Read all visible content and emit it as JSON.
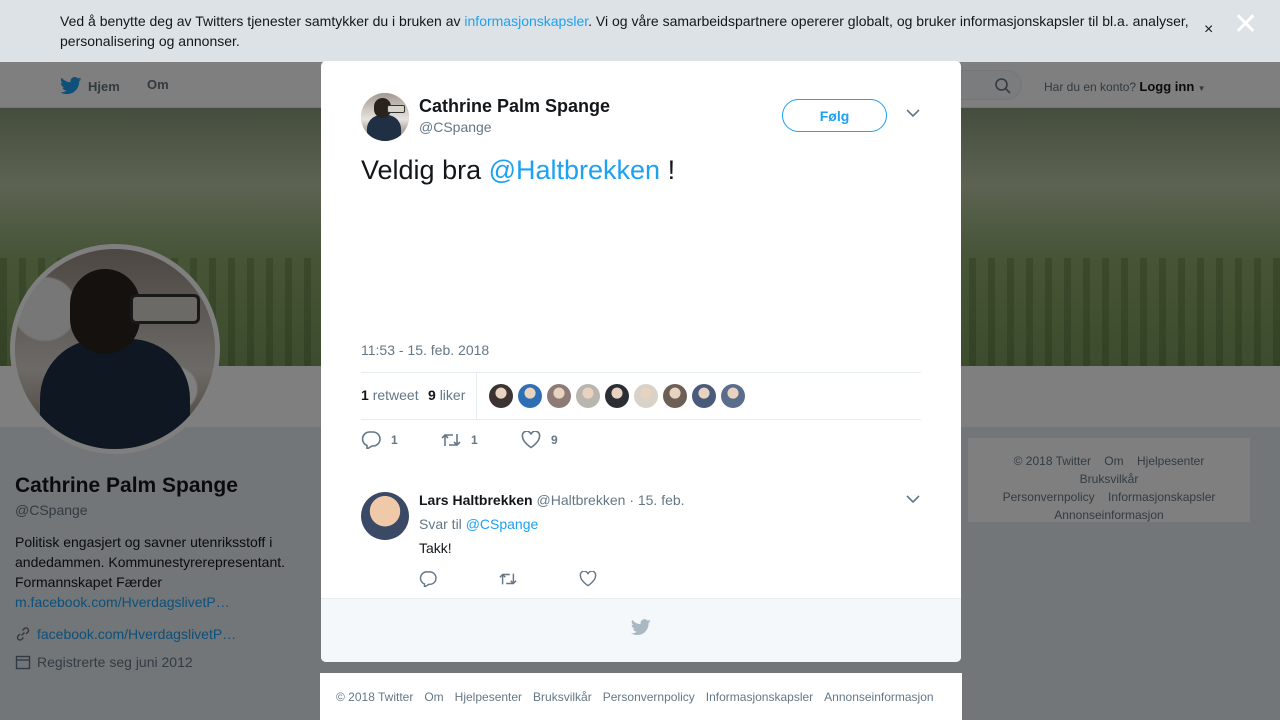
{
  "cookie_banner": {
    "text_before": "Ved å benytte deg av Twitters tjenester samtykker du i bruken av ",
    "link": "informasjonskapsler",
    "text_after": ". Vi og våre samarbeidspartnere opererer globalt, og bruker informasjonskapsler til bl.a. analyser, personalisering og annonser.",
    "close": "×"
  },
  "modal_close": "✕",
  "nav": {
    "home": "Hjem",
    "about": "Om",
    "account_prompt": "Har du en konto?",
    "login": "Logg inn"
  },
  "profile": {
    "name": "Cathrine Palm Spange",
    "handle": "@CSpange",
    "bio": "Politisk engasjert og savner utenriksstoff i andedammen. Kommunestyrerepresentant. Formannskapet Færder",
    "bio_link": "m.facebook.com/HverdagslivetP…",
    "website": "facebook.com/HverdagslivetP…",
    "joined": "Registrerte seg juni 2012"
  },
  "side_footer": [
    "© 2018 Twitter",
    "Om",
    "Hjelpesenter",
    "Bruksvilkår",
    "Personvernpolicy",
    "Informasjonskapsler",
    "Annonseinformasjon"
  ],
  "tweet": {
    "author_name": "Cathrine Palm Spange",
    "author_handle": "@CSpange",
    "follow_label": "Følg",
    "text": "Veldig bra ",
    "mention": "@Haltbrekken",
    "text_end": " !",
    "timestamp": "11:53 - 15. feb. 2018",
    "retweets_count": "1",
    "retweets_label": "retweet",
    "likes_count": "9",
    "likes_label": "liker",
    "reply_action_count": "1",
    "retweet_action_count": "1",
    "like_action_count": "9",
    "liker_colors": [
      "#3b3432",
      "#2f6fb3",
      "#8c7b76",
      "#b9b6b0",
      "#2b2e33",
      "#d8d2c9",
      "#6c5f55",
      "#4a5a7a",
      "#5a6d8a"
    ]
  },
  "reply": {
    "author_name": "Lars Haltbrekken",
    "author_handle": "@Haltbrekken",
    "date": "· 15. feb.",
    "reply_to_label": "Svar til",
    "reply_to_handle": "@CSpange",
    "text": "Takk!"
  },
  "bottom_footer": [
    "© 2018 Twitter",
    "Om",
    "Hjelpesenter",
    "Bruksvilkår",
    "Personvernpolicy",
    "Informasjonskapsler",
    "Annonseinformasjon"
  ],
  "colors": {
    "accent": "#1da1f2",
    "muted": "#657786",
    "text": "#14171a"
  }
}
